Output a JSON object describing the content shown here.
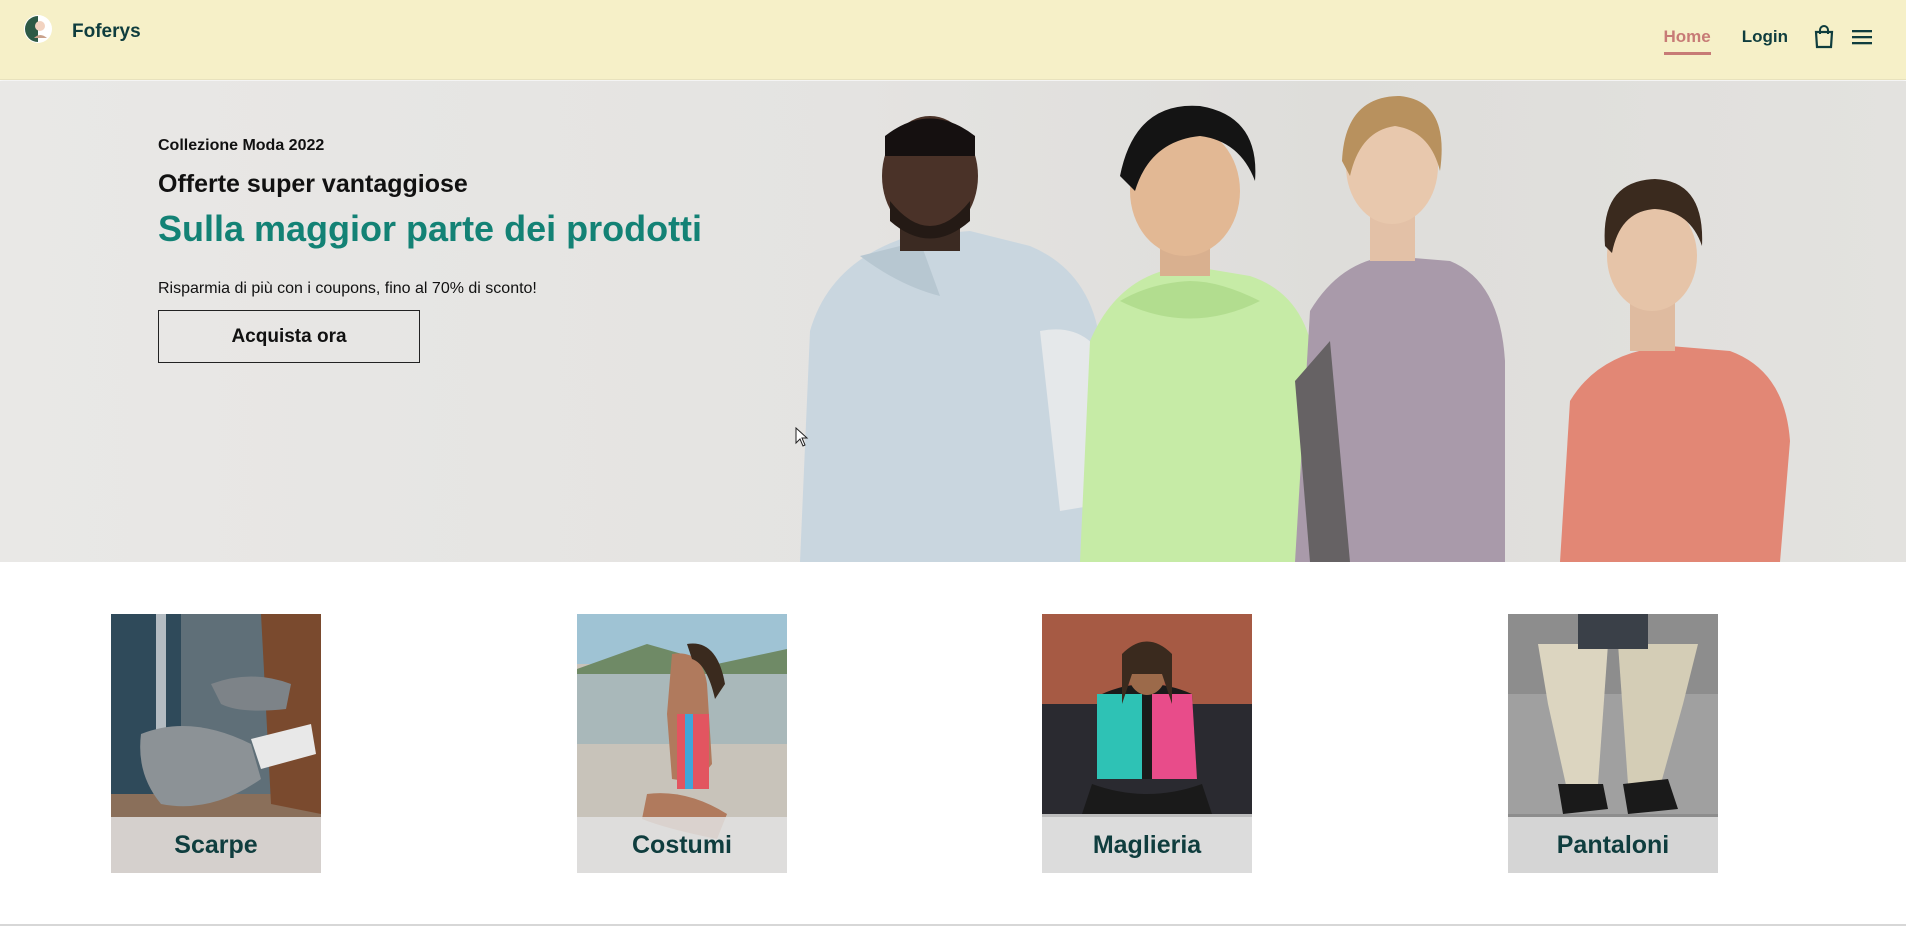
{
  "header": {
    "brand": "Foferys",
    "nav": {
      "home": "Home",
      "login": "Login"
    },
    "icons": [
      "bag-icon",
      "menu-icon"
    ],
    "colors": {
      "background": "#f6f0c8",
      "brand_text": "#0f3d3e",
      "active_link": "#c77b76"
    }
  },
  "hero": {
    "eyebrow": "Collezione Moda 2022",
    "title": "Offerte super vantaggiose",
    "highlight": "Sulla maggior parte dei prodotti",
    "description": "Risparmia di più con i coupons, fino al 70% di sconto!",
    "cta": "Acquista ora",
    "colors": {
      "highlight": "#138275"
    }
  },
  "categories": [
    {
      "label": "Scarpe"
    },
    {
      "label": "Costumi"
    },
    {
      "label": "Maglieria"
    },
    {
      "label": "Pantaloni"
    }
  ]
}
